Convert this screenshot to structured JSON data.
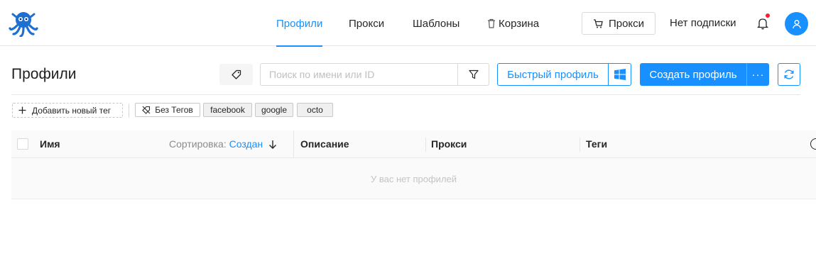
{
  "nav": {
    "items": [
      {
        "label": "Профили",
        "active": true
      },
      {
        "label": "Прокси"
      },
      {
        "label": "Шаблоны"
      },
      {
        "label": "Корзина",
        "icon": "trash-icon"
      }
    ],
    "proxy_button": {
      "label": "Прокси",
      "icon": "cart-icon"
    },
    "subscription": "Нет подписки",
    "notification_icon": "bell-icon",
    "avatar_icon": "user-icon"
  },
  "toolbar": {
    "title": "Профили",
    "tag_filter_icon": "tag-icon",
    "search_placeholder": "Поиск по имени или ID",
    "search_value": "",
    "filter_icon": "filter-icon",
    "quick_profile_label": "Быстрый профиль",
    "os_icon": "windows-icon",
    "create_profile_label": "Создать профиль",
    "more_label": "···",
    "refresh_icon": "refresh-icon"
  },
  "tags": {
    "add_label": "Добавить новый тег",
    "no_tags_label": "Без Тегов",
    "items": [
      "facebook",
      "google",
      "octo"
    ]
  },
  "table": {
    "columns": {
      "name": "Имя",
      "sort_label": "Сортировка:",
      "sort_value": "Создан",
      "description": "Описание",
      "proxy": "Прокси",
      "tags": "Теги"
    },
    "empty_text": "У вас нет профилей"
  },
  "colors": {
    "accent": "#1890ff",
    "logo": "#1d6fd1",
    "notification_dot": "#f5222d"
  }
}
